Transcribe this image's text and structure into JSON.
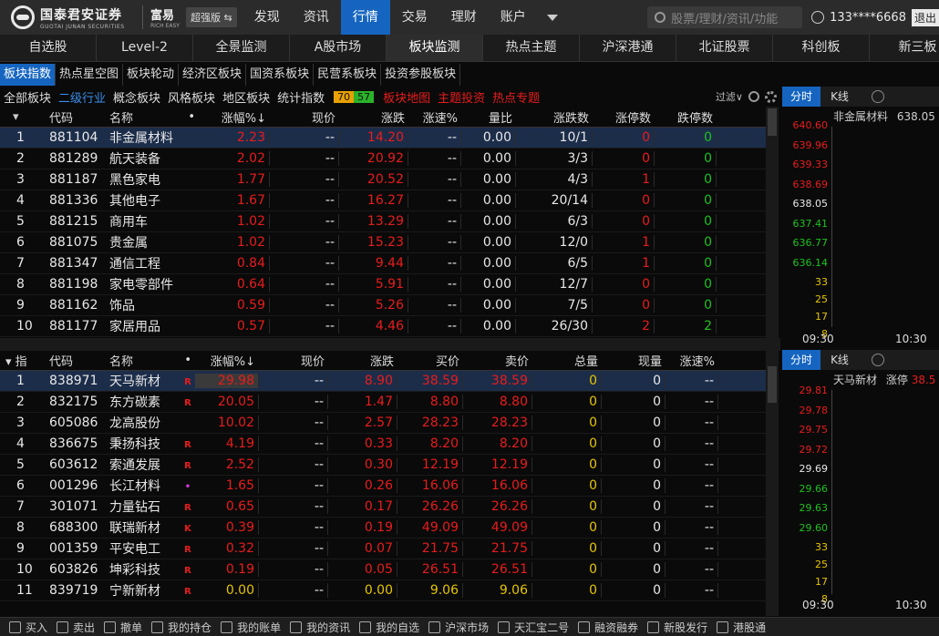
{
  "app": {
    "logo_cn": "国泰君安证券",
    "logo_en": "GUOTAI JUNAN SECURITIES",
    "brand_cn": "富易",
    "brand_en": "RICH EASY",
    "edition": "超强版 ⇆"
  },
  "topnav": [
    "发现",
    "资讯",
    "行情",
    "交易",
    "理财",
    "账户"
  ],
  "search_placeholder": "股票/理财/资讯/功能",
  "user": {
    "account": "133****6668",
    "logout": "退出"
  },
  "tabs": [
    "自选股",
    "Level-2",
    "全景监测",
    "A股市场",
    "板块监测",
    "热点主题",
    "沪深港通",
    "北证股票",
    "科创板",
    "新三板"
  ],
  "sub1": [
    "板块指数",
    "热点星空图",
    "板块轮动",
    "经济区板块",
    "国资系板块",
    "民营系板块",
    "投资参股板块"
  ],
  "sub2": {
    "items": [
      "全部板块",
      "二级行业",
      "概念板块",
      "风格板块",
      "地区板块",
      "统计指数"
    ],
    "up_count": "70",
    "down_count": "57",
    "hot": [
      "板块地图",
      "主题投资",
      "热点专题"
    ],
    "filter": "过滤∨"
  },
  "table1": {
    "headers": [
      "代码",
      "名称",
      "•",
      "涨幅%↓",
      "现价",
      "涨跌",
      "涨速%",
      "量比",
      "涨跌数",
      "涨停数",
      "跌停数"
    ],
    "rows": [
      {
        "n": "1",
        "code": "881104",
        "name": "非金属材料",
        "chg": "2.23",
        "price": "--",
        "diff": "14.20",
        "speed": "--",
        "vr": "0.00",
        "ud": "10/1",
        "zt": "0",
        "dt": "0"
      },
      {
        "n": "2",
        "code": "881289",
        "name": "航天装备",
        "chg": "2.02",
        "price": "--",
        "diff": "20.92",
        "speed": "--",
        "vr": "0.00",
        "ud": "3/3",
        "zt": "0",
        "dt": "0"
      },
      {
        "n": "3",
        "code": "881187",
        "name": "黑色家电",
        "chg": "1.77",
        "price": "--",
        "diff": "20.52",
        "speed": "--",
        "vr": "0.00",
        "ud": "4/3",
        "zt": "1",
        "dt": "0"
      },
      {
        "n": "4",
        "code": "881336",
        "name": "其他电子",
        "chg": "1.67",
        "price": "--",
        "diff": "16.27",
        "speed": "--",
        "vr": "0.00",
        "ud": "20/14",
        "zt": "0",
        "dt": "0"
      },
      {
        "n": "5",
        "code": "881215",
        "name": "商用车",
        "chg": "1.02",
        "price": "--",
        "diff": "13.29",
        "speed": "--",
        "vr": "0.00",
        "ud": "6/3",
        "zt": "0",
        "dt": "0"
      },
      {
        "n": "6",
        "code": "881075",
        "name": "贵金属",
        "chg": "1.02",
        "price": "--",
        "diff": "15.23",
        "speed": "--",
        "vr": "0.00",
        "ud": "12/0",
        "zt": "1",
        "dt": "0"
      },
      {
        "n": "7",
        "code": "881347",
        "name": "通信工程",
        "chg": "0.84",
        "price": "--",
        "diff": "9.44",
        "speed": "--",
        "vr": "0.00",
        "ud": "6/5",
        "zt": "1",
        "dt": "0"
      },
      {
        "n": "8",
        "code": "881198",
        "name": "家电零部件",
        "chg": "0.64",
        "price": "--",
        "diff": "5.91",
        "speed": "--",
        "vr": "0.00",
        "ud": "12/7",
        "zt": "0",
        "dt": "0"
      },
      {
        "n": "9",
        "code": "881162",
        "name": "饰品",
        "chg": "0.59",
        "price": "--",
        "diff": "5.26",
        "speed": "--",
        "vr": "0.00",
        "ud": "7/5",
        "zt": "0",
        "dt": "0"
      },
      {
        "n": "10",
        "code": "881177",
        "name": "家居用品",
        "chg": "0.57",
        "price": "--",
        "diff": "4.46",
        "speed": "--",
        "vr": "0.00",
        "ud": "26/30",
        "zt": "2",
        "dt": "2"
      }
    ]
  },
  "table2": {
    "headers": [
      "指",
      "代码",
      "名称",
      "•",
      "涨幅%↓",
      "现价",
      "涨跌",
      "买价",
      "卖价",
      "总量",
      "现量",
      "涨速%"
    ],
    "rows": [
      {
        "n": "1",
        "code": "838971",
        "name": "天马新材",
        "tag": "R",
        "chg": "29.98",
        "price": "--",
        "diff": "8.90",
        "buy": "38.59",
        "sell": "38.59",
        "vol": "0",
        "cur": "0",
        "speed": "--"
      },
      {
        "n": "2",
        "code": "832175",
        "name": "东方碳素",
        "tag": "R",
        "chg": "20.05",
        "price": "--",
        "diff": "1.47",
        "buy": "8.80",
        "sell": "8.80",
        "vol": "0",
        "cur": "0",
        "speed": "--"
      },
      {
        "n": "3",
        "code": "605086",
        "name": "龙高股份",
        "tag": "",
        "chg": "10.02",
        "price": "--",
        "diff": "2.57",
        "buy": "28.23",
        "sell": "28.23",
        "vol": "0",
        "cur": "0",
        "speed": "--"
      },
      {
        "n": "4",
        "code": "836675",
        "name": "秉扬科技",
        "tag": "R",
        "chg": "4.19",
        "price": "--",
        "diff": "0.33",
        "buy": "8.20",
        "sell": "8.20",
        "vol": "0",
        "cur": "0",
        "speed": "--"
      },
      {
        "n": "5",
        "code": "603612",
        "name": "索通发展",
        "tag": "R",
        "chg": "2.52",
        "price": "--",
        "diff": "0.30",
        "buy": "12.19",
        "sell": "12.19",
        "vol": "0",
        "cur": "0",
        "speed": "--"
      },
      {
        "n": "6",
        "code": "001296",
        "name": "长江材料",
        "tag": "•",
        "chg": "1.65",
        "price": "--",
        "diff": "0.26",
        "buy": "16.06",
        "sell": "16.06",
        "vol": "0",
        "cur": "0",
        "speed": "--"
      },
      {
        "n": "7",
        "code": "301071",
        "name": "力量钻石",
        "tag": "R",
        "chg": "0.65",
        "price": "--",
        "diff": "0.17",
        "buy": "26.26",
        "sell": "26.26",
        "vol": "0",
        "cur": "0",
        "speed": "--"
      },
      {
        "n": "8",
        "code": "688300",
        "name": "联瑞新材",
        "tag": "K",
        "chg": "0.39",
        "price": "--",
        "diff": "0.19",
        "buy": "49.09",
        "sell": "49.09",
        "vol": "0",
        "cur": "0",
        "speed": "--"
      },
      {
        "n": "9",
        "code": "001359",
        "name": "平安电工",
        "tag": "R",
        "chg": "0.32",
        "price": "--",
        "diff": "0.07",
        "buy": "21.75",
        "sell": "21.75",
        "vol": "0",
        "cur": "0",
        "speed": "--"
      },
      {
        "n": "10",
        "code": "603826",
        "name": "坤彩科技",
        "tag": "R",
        "chg": "0.19",
        "price": "--",
        "diff": "0.05",
        "buy": "26.51",
        "sell": "26.51",
        "vol": "0",
        "cur": "0",
        "speed": "--"
      },
      {
        "n": "11",
        "code": "839719",
        "name": "宁新新材",
        "tag": "R",
        "chg": "0.00",
        "price": "--",
        "diff": "0.00",
        "buy": "9.06",
        "sell": "9.06",
        "vol": "0",
        "cur": "0",
        "speed": "--"
      }
    ]
  },
  "chart1": {
    "tab_a": "分时",
    "tab_b": "K线",
    "name": "非金属材料",
    "price": "638.05",
    "prices": [
      "640.60",
      "639.96",
      "639.33",
      "638.69",
      "638.05",
      "637.41",
      "636.77",
      "636.14"
    ],
    "vols": [
      "33",
      "25",
      "17",
      "8"
    ],
    "t1": "09:30",
    "t2": "10:30"
  },
  "chart2": {
    "tab_a": "分时",
    "tab_b": "K线",
    "name": "天马新材",
    "status": "涨停",
    "price": "38.5",
    "prices": [
      "29.81",
      "29.78",
      "29.75",
      "29.72",
      "29.69",
      "29.66",
      "29.63",
      "29.60"
    ],
    "vols": [
      "33",
      "25",
      "17",
      "8"
    ],
    "t1": "09:30",
    "t2": "10:30"
  },
  "bottom": [
    "买入",
    "卖出",
    "撤单",
    "我的持仓",
    "我的账单",
    "我的资讯",
    "我的自选",
    "沪深市场",
    "天汇宝二号",
    "融资融券",
    "新股发行",
    "港股通"
  ],
  "colors": {
    "accent": "#1565c0",
    "up": "#e81c1c",
    "down": "#1fc11f",
    "neutral": "#e5c400"
  }
}
